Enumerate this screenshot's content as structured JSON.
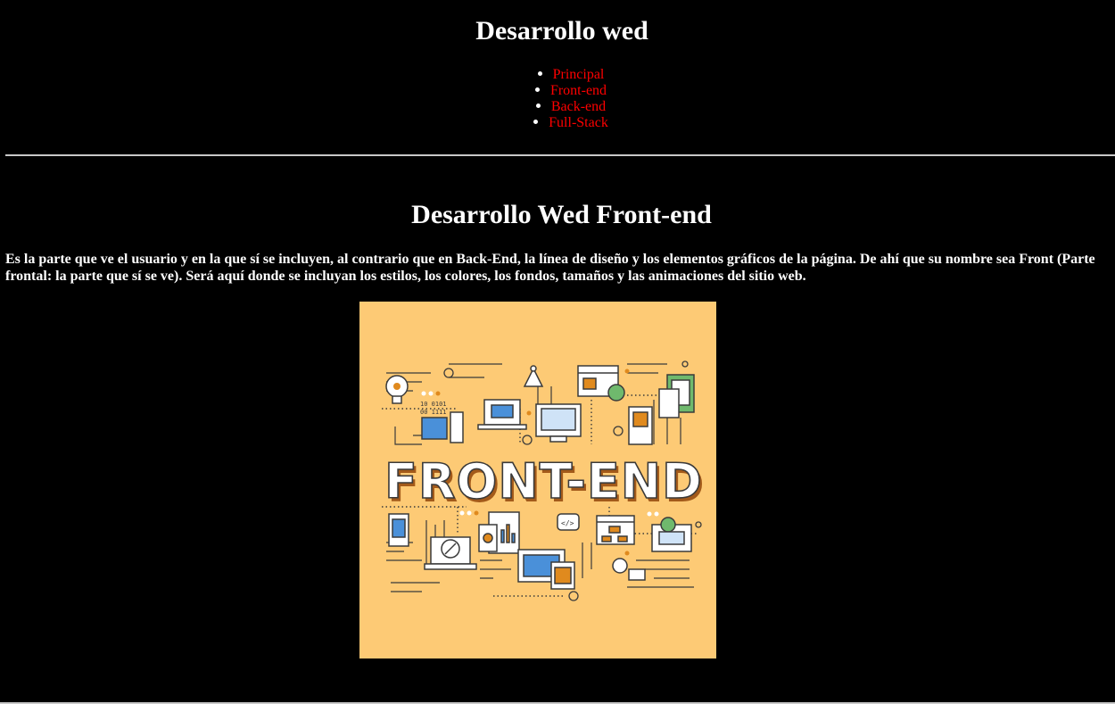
{
  "header": {
    "title": "Desarrollo wed"
  },
  "nav": {
    "items": [
      {
        "label": "Principal"
      },
      {
        "label": "Front-end"
      },
      {
        "label": "Back-end"
      },
      {
        "label": "Full-Stack"
      }
    ]
  },
  "main": {
    "section_title": "Desarrollo Wed Front-end",
    "intro": "Es la parte que ve el usuario y en la que sí se incluyen, al contrario que en Back-End, la línea de diseño y los elementos gráficos de la página. De ahí que su nombre sea Front (Parte frontal: la parte que sí se ve). Será aquí donde se incluyan los estilos, los colores, los fondos, tamaños y las animaciones del sitio web.",
    "hero_image": {
      "lettering": "FRONT-END",
      "background": "#fdca75"
    }
  },
  "colors": {
    "page_background": "#000000",
    "text": "#ffffff",
    "link": "#ff0000"
  }
}
